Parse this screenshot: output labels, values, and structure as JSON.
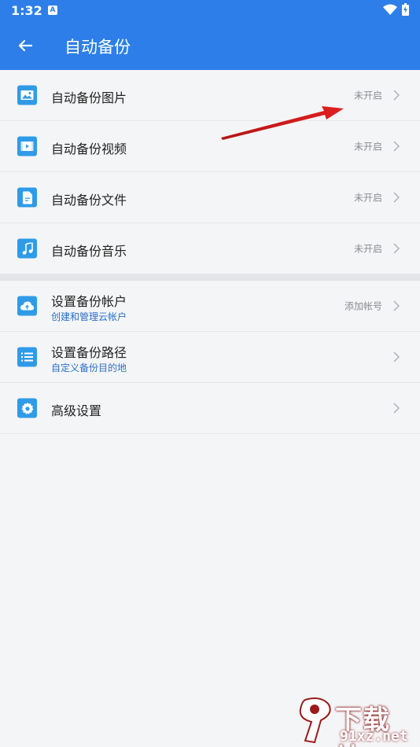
{
  "status_bar": {
    "time": "1:32",
    "notif_letter": "A"
  },
  "header": {
    "title": "自动备份"
  },
  "group1": [
    {
      "label": "自动备份图片",
      "status": "未开启",
      "icon": "image-icon"
    },
    {
      "label": "自动备份视频",
      "status": "未开启",
      "icon": "video-icon"
    },
    {
      "label": "自动备份文件",
      "status": "未开启",
      "icon": "file-icon"
    },
    {
      "label": "自动备份音乐",
      "status": "未开启",
      "icon": "music-icon"
    }
  ],
  "group2": [
    {
      "label": "设置备份帐户",
      "sub": "创建和管理云帐户",
      "status": "添加帐号",
      "icon": "cloud-icon"
    },
    {
      "label": "设置备份路径",
      "sub": "自定义备份目的地",
      "status": "",
      "icon": "list-icon"
    },
    {
      "label": "高级设置",
      "sub": "",
      "status": "",
      "icon": "gear-icon"
    }
  ],
  "watermark": {
    "line1": "下载站",
    "line2": "91xz.net"
  },
  "colors": {
    "header_bg": "#2d7ee8",
    "icon_bg": "#2f9be8",
    "arrow": "#d42020"
  }
}
